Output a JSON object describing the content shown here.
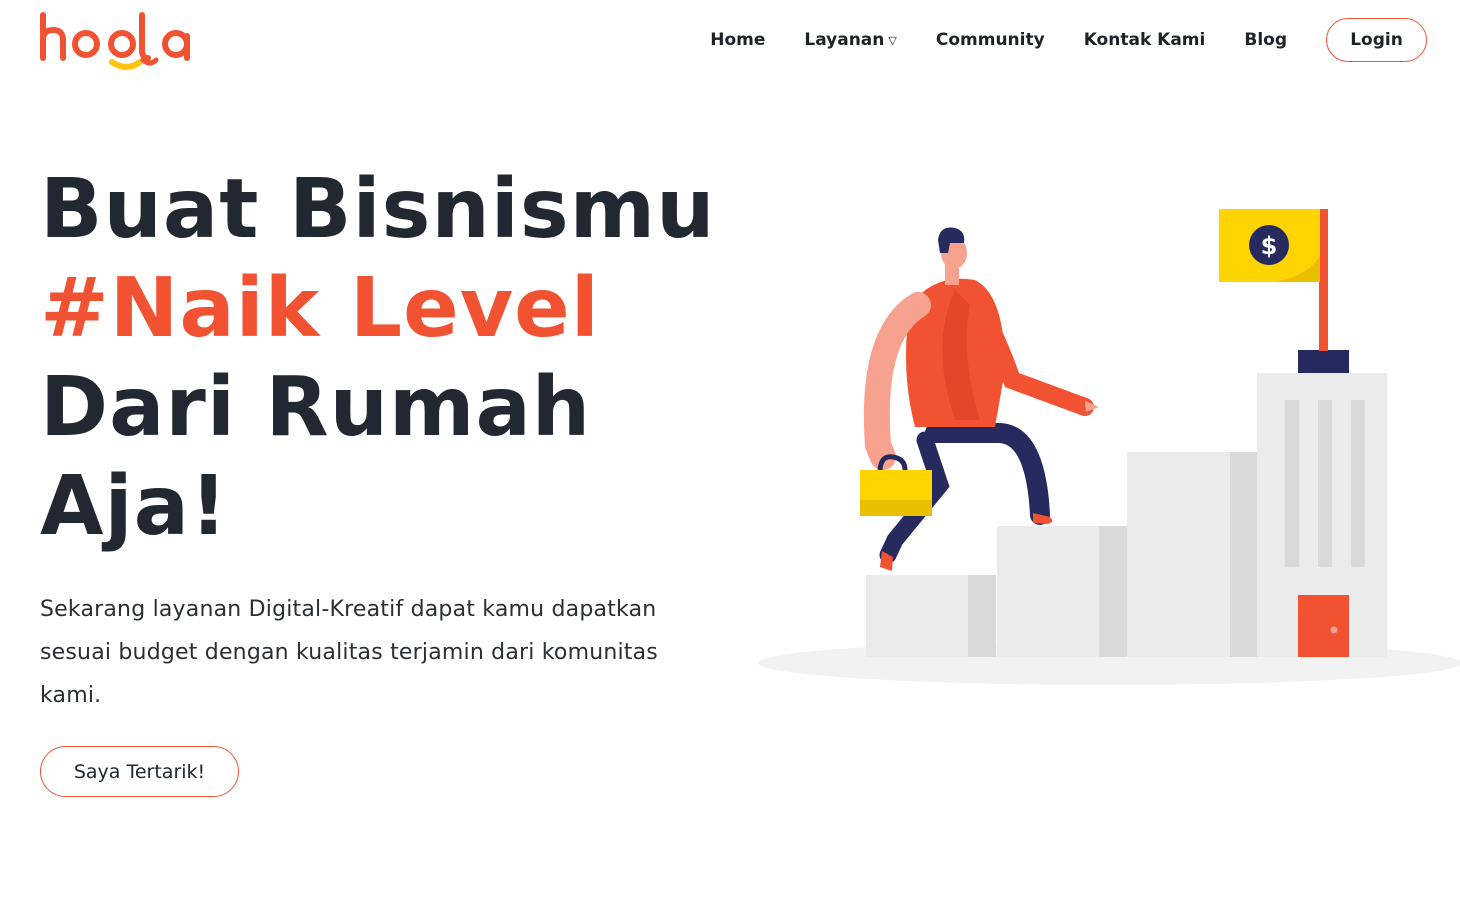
{
  "brand": {
    "logo_text": "hoola",
    "accent_color": "#f05232",
    "smile_color": "#ffc20e"
  },
  "nav": {
    "items": [
      {
        "label": "Home"
      },
      {
        "label": "Layanan",
        "has_dropdown": true
      },
      {
        "label": "Community"
      },
      {
        "label": "Kontak Kami"
      },
      {
        "label": "Blog"
      }
    ],
    "login_label": "Login",
    "dropdown_icon": "chevron-down-icon"
  },
  "hero": {
    "title_lines": [
      "Buat Bisnismu",
      "#Naik Level",
      "Dari Rumah",
      "Aja!"
    ],
    "description": "Sekarang layanan Digital-Kreatif dapat kamu dapatkan sesuai budget dengan kualitas terjamin dari komunitas kami.",
    "cta_label": "Saya Tertarik!"
  },
  "illustration": {
    "flag_symbol": "$",
    "icon": "growth-stairs-illustration"
  },
  "colors": {
    "text_dark": "#222831",
    "accent": "#f05232",
    "flag_yellow": "#ffd400",
    "navy": "#262a5e"
  }
}
